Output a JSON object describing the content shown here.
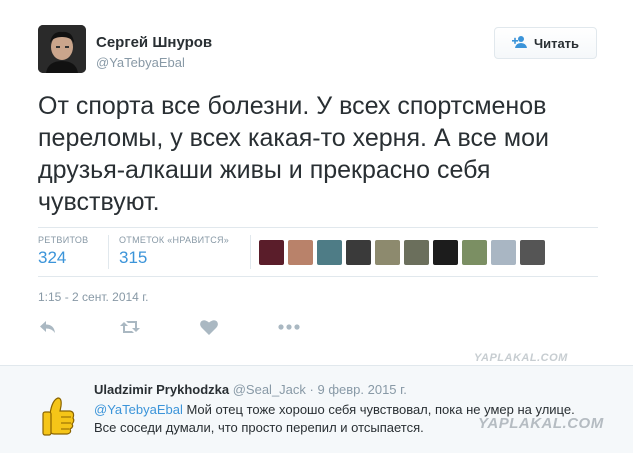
{
  "tweet": {
    "author_name": "Сергей Шнуров",
    "author_handle": "@YaTebyaEbal",
    "follow_label": "Читать",
    "text": "От спорта все болезни. У всех спортсменов переломы, у всех какая-то херня. А все мои друзья-алкаши живы и прекрасно себя чувствуют.",
    "retweets_label": "РЕТВИТОВ",
    "retweets_count": "324",
    "likes_label": "ОТМЕТОК «НРАВИТСЯ»",
    "likes_count": "315",
    "timestamp": "1:15 - 2 сент. 2014 г.",
    "actions": [
      "reply-icon",
      "retweet-icon",
      "like-icon",
      "more-icon"
    ]
  },
  "reply": {
    "author_name": "Uladzimir Prykhodzka",
    "author_handle": "@Seal_Jack",
    "date": "· 9 февр. 2015 г.",
    "mention": "@YaTebyaEbal",
    "text": " Мой отец тоже хорошо себя чувствовал, пока не умер на улице. Все соседи думали, что просто перепил и отсыпается."
  },
  "watermarks": {
    "top": "YAPLAKAL.COM",
    "bottom": "YAPLAKAL.COM"
  },
  "colors": {
    "link": "#3b94d9",
    "muted": "#8899a6",
    "text": "#292f33",
    "border": "#e1e8ed",
    "reply_bg": "#f5f8fa"
  }
}
